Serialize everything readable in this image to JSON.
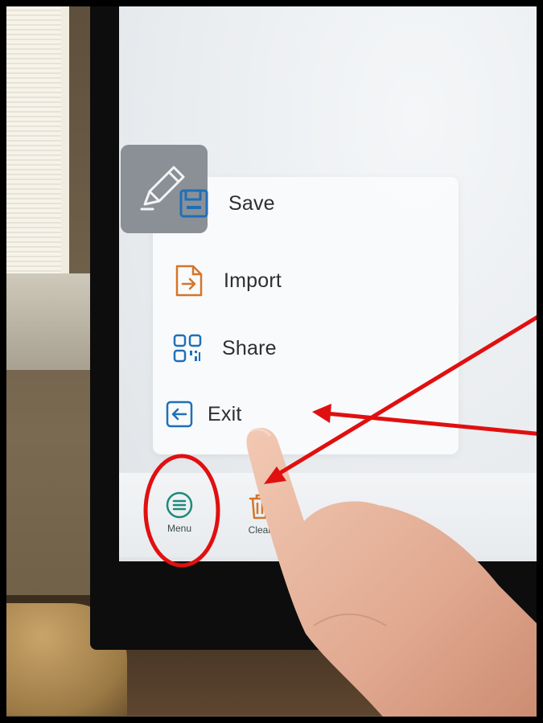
{
  "menu": {
    "items": [
      {
        "label": "Save",
        "icon": "save-icon",
        "color": "#1f6fb8"
      },
      {
        "label": "Import",
        "icon": "import-icon",
        "color": "#d4752a"
      },
      {
        "label": "Share",
        "icon": "qr-code-icon",
        "color": "#1f6fb8"
      },
      {
        "label": "Exit",
        "icon": "exit-icon",
        "color": "#1f6fb8"
      }
    ]
  },
  "toolbar": {
    "menu_label": "Menu",
    "menu_icon": "hamburger-circle-icon",
    "menu_color": "#1b8a7a",
    "clear_label": "Clear",
    "clear_icon": "trash-icon",
    "clear_color": "#d4752a"
  },
  "annotation_color": "#e01010"
}
